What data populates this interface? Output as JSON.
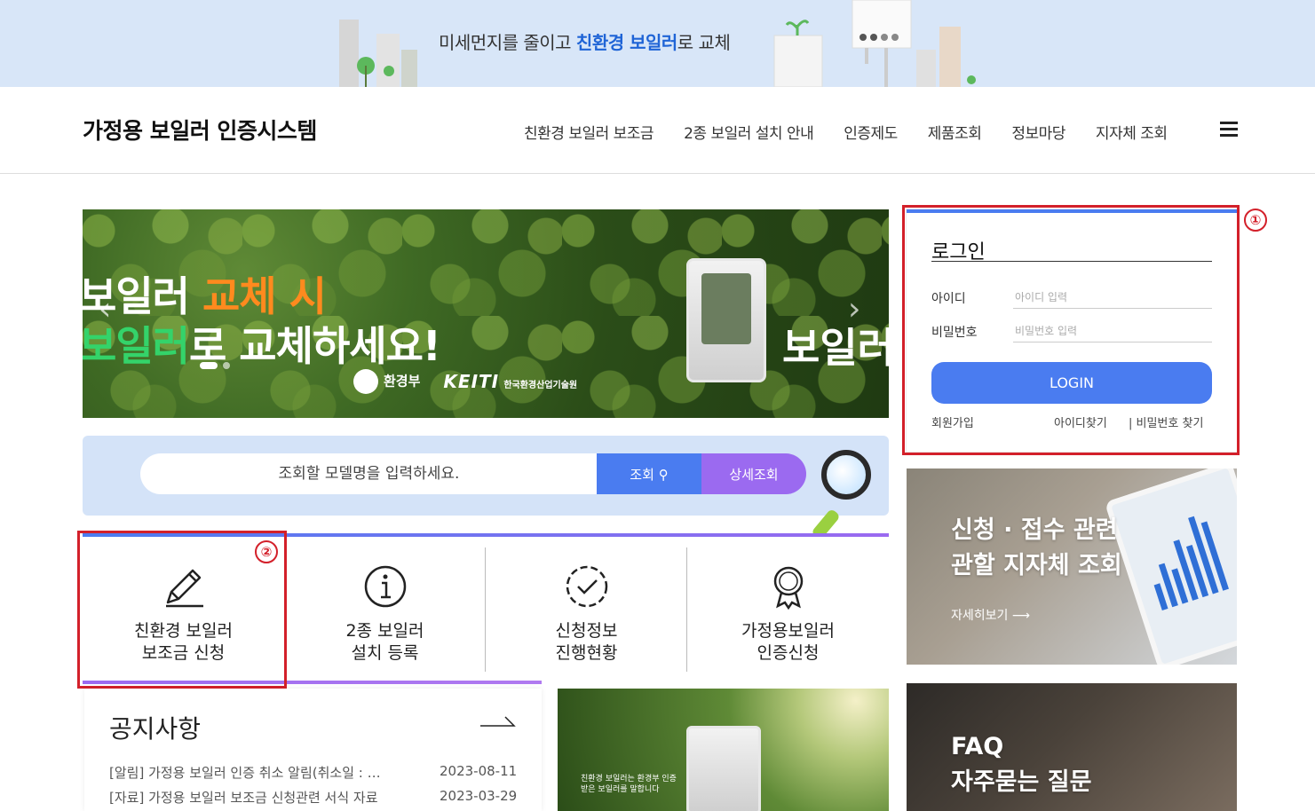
{
  "promo": {
    "text_before": "미세먼지를 줄이고 ",
    "text_highlight": "친환경 보일러",
    "text_after": "로 교체"
  },
  "header": {
    "site_title": "가정용 보일러 인증시스템",
    "nav": [
      "친환경 보일러 보조금",
      "2종 보일러 설치 안내",
      "인증제도",
      "제품조회",
      "정보마당",
      "지자체 조회"
    ]
  },
  "hero": {
    "line1_a": "보일러 ",
    "line1_b": "교체 시",
    "line2_a": "보일러",
    "line2_b": "로 교체하세요!",
    "right_text": "보일러",
    "logo_moe": "환경부",
    "logo_keiti": "KEITI",
    "logo_keiti_sub": "한국환경산업기술원"
  },
  "login": {
    "title": "로그인",
    "id_label": "아이디",
    "id_placeholder": "아이디 입력",
    "pw_label": "비밀번호",
    "pw_placeholder": "비밀번호 입력",
    "button": "LOGIN",
    "join": "회원가입",
    "find_id": "아이디찾기",
    "find_pw": "| 비밀번호 찾기"
  },
  "callouts": {
    "one": "①",
    "two": "②"
  },
  "search": {
    "placeholder": "조회할 모델명을 입력하세요.",
    "search_button": "조회",
    "detail_button": "상세조회"
  },
  "quick_menu": [
    {
      "line1": "친환경 보일러",
      "line2": "보조금 신청",
      "icon": "pencil-icon"
    },
    {
      "line1": "2종 보일러",
      "line2": "설치 등록",
      "icon": "info-icon"
    },
    {
      "line1": "신청정보",
      "line2": "진행현황",
      "icon": "check-circle-icon"
    },
    {
      "line1": "가정용보일러",
      "line2": "인증신청",
      "icon": "award-icon"
    }
  ],
  "notice": {
    "title": "공지사항",
    "items": [
      {
        "title": "[알림] 가정용 보일러 인증 취소 알림(취소일 : …",
        "date": "2023-08-11"
      },
      {
        "title": "[자료] 가정용 보일러 보조금 신청관련 서식 자료",
        "date": "2023-03-29"
      }
    ]
  },
  "forest_caption": {
    "line1": "친환경 보일러는 환경부 인증",
    "line2": "받은 보일러를 말합니다"
  },
  "cards": {
    "card1_line1": "신청 · 접수 관련",
    "card1_line2": "관할 지자체 조회",
    "card1_more": "자세히보기",
    "card2_line1": "FAQ",
    "card2_line2": "자주묻는 질문"
  },
  "colors": {
    "accent_blue": "#4a7cf0",
    "accent_purple": "#9b6af0",
    "highlight_red": "#d3202a",
    "promo_bg": "#d8e6f8"
  }
}
